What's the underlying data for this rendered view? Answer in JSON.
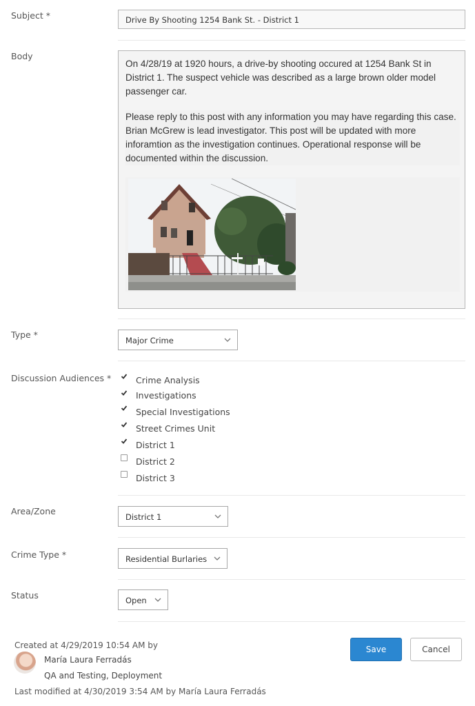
{
  "subject": {
    "label": "Subject *",
    "value": "Drive By Shooting 1254 Bank St. - District 1"
  },
  "body": {
    "label": "Body",
    "paragraph1": "On 4/28/19 at 1920 hours, a drive-by shooting occured at 1254 Bank St in District 1.  The suspect vehicle was described as a large brown older model passenger car.",
    "paragraph2": "Please reply to this post with any information you may have regarding this case.  Brian McGrew is lead investigator.  This post will be updated with more inforamtion as the investigation continues.  Operational response will be documented within the discussion."
  },
  "type": {
    "label": "Type *",
    "value": "Major Crime"
  },
  "audiences": {
    "label": "Discussion Audiences *",
    "items": [
      {
        "label": "Crime Analysis",
        "checked": true
      },
      {
        "label": "Investigations",
        "checked": true
      },
      {
        "label": "Special Investigations",
        "checked": true
      },
      {
        "label": "Street Crimes Unit",
        "checked": true
      },
      {
        "label": "District 1",
        "checked": true
      },
      {
        "label": "District 2",
        "checked": false
      },
      {
        "label": "District 3",
        "checked": false
      }
    ]
  },
  "area_zone": {
    "label": "Area/Zone",
    "value": "District 1"
  },
  "crime_type": {
    "label": "Crime Type *",
    "value": "Residential Burlaries"
  },
  "status": {
    "label": "Status",
    "value": "Open"
  },
  "footer": {
    "created": "Created at 4/29/2019 10:54 AM  by",
    "author_name": "María Laura Ferradás",
    "author_org": "QA and Testing, Deployment",
    "modified": "Last modified at 4/30/2019 3:54 AM  by María Laura Ferradás"
  },
  "buttons": {
    "save": "Save",
    "cancel": "Cancel"
  },
  "colors": {
    "primary": "#2b87d1",
    "border": "#b5b5b5"
  }
}
